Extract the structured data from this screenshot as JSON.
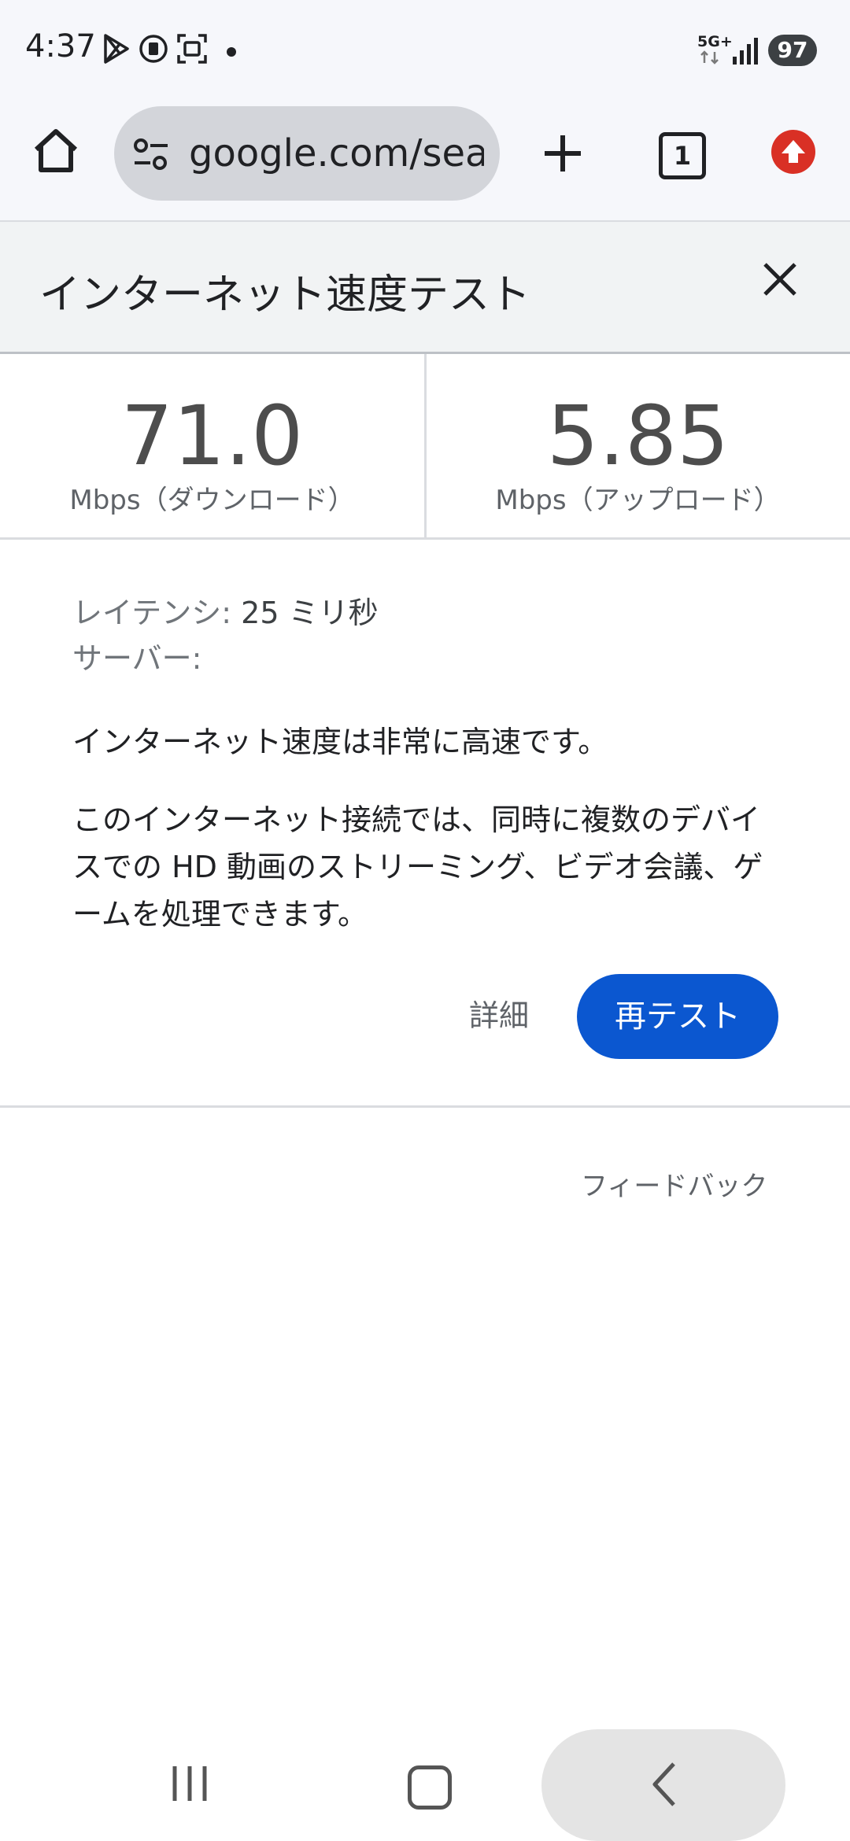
{
  "status_bar": {
    "time": "4:37",
    "icons": [
      "play-store-icon",
      "sim-icon",
      "screenshot-icon",
      "notification-dot"
    ],
    "network": "5G+",
    "battery": "97"
  },
  "browser": {
    "url": "google.com/search",
    "tab_count": "1",
    "icons": [
      "home-icon",
      "site-settings-icon",
      "new-tab-icon",
      "tabs-icon",
      "update-icon"
    ]
  },
  "speed_test": {
    "title": "インターネット速度テスト",
    "download_value": "71.0",
    "download_unit": "Mbps（ダウンロード）",
    "upload_value": "5.85",
    "upload_unit": "Mbps（アップロード）",
    "latency_label": "レイテンシ:",
    "latency_value": "25 ミリ秒",
    "server_label": "サーバー:",
    "summary": "インターネット速度は非常に高速です。",
    "description": "このインターネット接続では、同時に複数のデバイスでの HD 動画のストリーミング、ビデオ会議、ゲームを処理できます。",
    "details_label": "詳細",
    "retest_label": "再テスト",
    "feedback_label": "フィードバック"
  },
  "nav_bar": {
    "icons": [
      "recents-icon",
      "home-button-icon",
      "back-icon"
    ]
  },
  "colors": {
    "accent": "#0b57d0",
    "update_badge": "#d93025",
    "header_bg": "#f1f3f4"
  }
}
